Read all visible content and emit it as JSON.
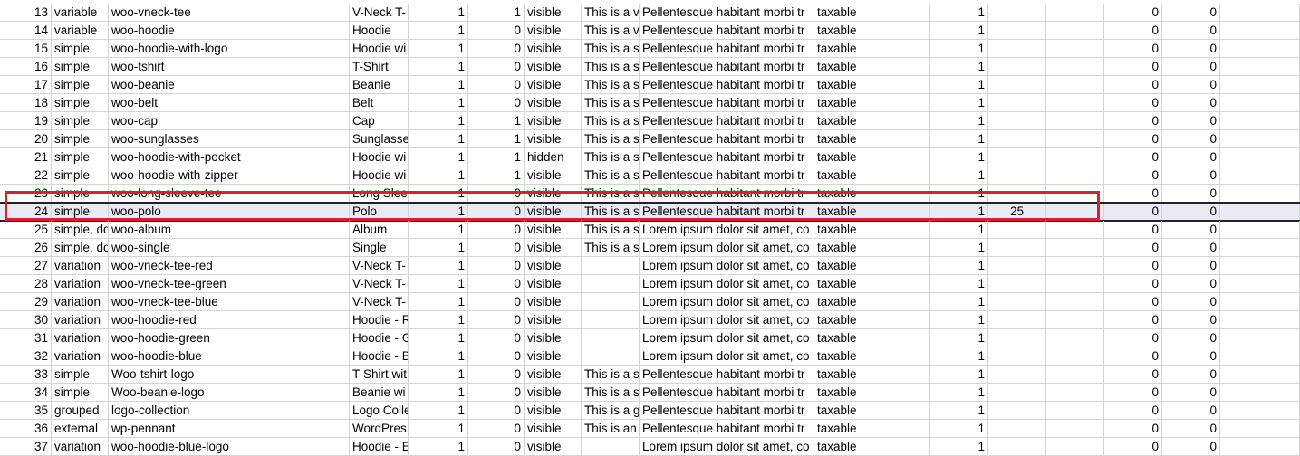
{
  "rows": [
    {
      "n": "13",
      "type": "variable",
      "sku": "woo-vneck-tee",
      "name": "V-Neck T-",
      "published": "1",
      "featured": "1",
      "visibility": "visible",
      "short": "This is a va",
      "desc": "Pellentesque habitant morbi tr",
      "tax": "taxable",
      "instock": "1",
      "stock": "",
      "v1": "0",
      "v2": "0"
    },
    {
      "n": "14",
      "type": "variable",
      "sku": "woo-hoodie",
      "name": "Hoodie",
      "published": "1",
      "featured": "0",
      "visibility": "visible",
      "short": "This is a va",
      "desc": "Pellentesque habitant morbi tr",
      "tax": "taxable",
      "instock": "1",
      "stock": "",
      "v1": "0",
      "v2": "0"
    },
    {
      "n": "15",
      "type": "simple",
      "sku": "woo-hoodie-with-logo",
      "name": "Hoodie wi",
      "published": "1",
      "featured": "0",
      "visibility": "visible",
      "short": "This is a si",
      "desc": "Pellentesque habitant morbi tr",
      "tax": "taxable",
      "instock": "1",
      "stock": "",
      "v1": "0",
      "v2": "0"
    },
    {
      "n": "16",
      "type": "simple",
      "sku": "woo-tshirt",
      "name": "T-Shirt",
      "published": "1",
      "featured": "0",
      "visibility": "visible",
      "short": "This is a si",
      "desc": "Pellentesque habitant morbi tr",
      "tax": "taxable",
      "instock": "1",
      "stock": "",
      "v1": "0",
      "v2": "0"
    },
    {
      "n": "17",
      "type": "simple",
      "sku": "woo-beanie",
      "name": "Beanie",
      "published": "1",
      "featured": "0",
      "visibility": "visible",
      "short": "This is a si",
      "desc": "Pellentesque habitant morbi tr",
      "tax": "taxable",
      "instock": "1",
      "stock": "",
      "v1": "0",
      "v2": "0"
    },
    {
      "n": "18",
      "type": "simple",
      "sku": "woo-belt",
      "name": "Belt",
      "published": "1",
      "featured": "0",
      "visibility": "visible",
      "short": "This is a si",
      "desc": "Pellentesque habitant morbi tr",
      "tax": "taxable",
      "instock": "1",
      "stock": "",
      "v1": "0",
      "v2": "0"
    },
    {
      "n": "19",
      "type": "simple",
      "sku": "woo-cap",
      "name": "Cap",
      "published": "1",
      "featured": "1",
      "visibility": "visible",
      "short": "This is a si",
      "desc": "Pellentesque habitant morbi tr",
      "tax": "taxable",
      "instock": "1",
      "stock": "",
      "v1": "0",
      "v2": "0"
    },
    {
      "n": "20",
      "type": "simple",
      "sku": "woo-sunglasses",
      "name": "Sunglasse",
      "published": "1",
      "featured": "1",
      "visibility": "visible",
      "short": "This is a si",
      "desc": "Pellentesque habitant morbi tr",
      "tax": "taxable",
      "instock": "1",
      "stock": "",
      "v1": "0",
      "v2": "0"
    },
    {
      "n": "21",
      "type": "simple",
      "sku": "woo-hoodie-with-pocket",
      "name": "Hoodie wi",
      "published": "1",
      "featured": "1",
      "visibility": "hidden",
      "short": "This is a si",
      "desc": "Pellentesque habitant morbi tr",
      "tax": "taxable",
      "instock": "1",
      "stock": "",
      "v1": "0",
      "v2": "0"
    },
    {
      "n": "22",
      "type": "simple",
      "sku": "woo-hoodie-with-zipper",
      "name": "Hoodie wi",
      "published": "1",
      "featured": "1",
      "visibility": "visible",
      "short": "This is a si",
      "desc": "Pellentesque habitant morbi tr",
      "tax": "taxable",
      "instock": "1",
      "stock": "",
      "v1": "0",
      "v2": "0"
    },
    {
      "n": "23",
      "type": "simple",
      "sku": "woo-long-sleeve-tee",
      "name": "Long Slee",
      "published": "1",
      "featured": "0",
      "visibility": "visible",
      "short": "This is a si",
      "desc": "Pellentesque habitant morbi tr",
      "tax": "taxable",
      "instock": "1",
      "stock": "",
      "v1": "0",
      "v2": "0"
    },
    {
      "n": "24",
      "type": "simple",
      "sku": "woo-polo",
      "name": "Polo",
      "published": "1",
      "featured": "0",
      "visibility": "visible",
      "short": "This is a si",
      "desc": "Pellentesque habitant morbi tr",
      "tax": "taxable",
      "instock": "1",
      "stock": "25",
      "v1": "0",
      "v2": "0",
      "selected": true
    },
    {
      "n": "25",
      "type": "simple, do",
      "sku": "woo-album",
      "name": "Album",
      "published": "1",
      "featured": "0",
      "visibility": "visible",
      "short": "This is a si",
      "desc": "Lorem ipsum dolor sit amet, co",
      "tax": "taxable",
      "instock": "1",
      "stock": "",
      "v1": "0",
      "v2": "0"
    },
    {
      "n": "26",
      "type": "simple, do",
      "sku": "woo-single",
      "name": "Single",
      "published": "1",
      "featured": "0",
      "visibility": "visible",
      "short": "This is a si",
      "desc": "Lorem ipsum dolor sit amet, co",
      "tax": "taxable",
      "instock": "1",
      "stock": "",
      "v1": "0",
      "v2": "0"
    },
    {
      "n": "27",
      "type": "variation",
      "sku": "woo-vneck-tee-red",
      "name": "V-Neck T-",
      "published": "1",
      "featured": "0",
      "visibility": "visible",
      "short": "",
      "desc": "Lorem ipsum dolor sit amet, co",
      "tax": "taxable",
      "instock": "1",
      "stock": "",
      "v1": "0",
      "v2": "0"
    },
    {
      "n": "28",
      "type": "variation",
      "sku": "woo-vneck-tee-green",
      "name": "V-Neck T-",
      "published": "1",
      "featured": "0",
      "visibility": "visible",
      "short": "",
      "desc": "Lorem ipsum dolor sit amet, co",
      "tax": "taxable",
      "instock": "1",
      "stock": "",
      "v1": "0",
      "v2": "0"
    },
    {
      "n": "29",
      "type": "variation",
      "sku": "woo-vneck-tee-blue",
      "name": "V-Neck T-",
      "published": "1",
      "featured": "0",
      "visibility": "visible",
      "short": "",
      "desc": "Lorem ipsum dolor sit amet, co",
      "tax": "taxable",
      "instock": "1",
      "stock": "",
      "v1": "0",
      "v2": "0"
    },
    {
      "n": "30",
      "type": "variation",
      "sku": "woo-hoodie-red",
      "name": "Hoodie - R",
      "published": "1",
      "featured": "0",
      "visibility": "visible",
      "short": "",
      "desc": "Lorem ipsum dolor sit amet, co",
      "tax": "taxable",
      "instock": "1",
      "stock": "",
      "v1": "0",
      "v2": "0"
    },
    {
      "n": "31",
      "type": "variation",
      "sku": "woo-hoodie-green",
      "name": "Hoodie - G",
      "published": "1",
      "featured": "0",
      "visibility": "visible",
      "short": "",
      "desc": "Lorem ipsum dolor sit amet, co",
      "tax": "taxable",
      "instock": "1",
      "stock": "",
      "v1": "0",
      "v2": "0"
    },
    {
      "n": "32",
      "type": "variation",
      "sku": "woo-hoodie-blue",
      "name": "Hoodie - B",
      "published": "1",
      "featured": "0",
      "visibility": "visible",
      "short": "",
      "desc": "Lorem ipsum dolor sit amet, co",
      "tax": "taxable",
      "instock": "1",
      "stock": "",
      "v1": "0",
      "v2": "0"
    },
    {
      "n": "33",
      "type": "simple",
      "sku": "Woo-tshirt-logo",
      "name": "T-Shirt wit",
      "published": "1",
      "featured": "0",
      "visibility": "visible",
      "short": "This is a si",
      "desc": "Pellentesque habitant morbi tr",
      "tax": "taxable",
      "instock": "1",
      "stock": "",
      "v1": "0",
      "v2": "0"
    },
    {
      "n": "34",
      "type": "simple",
      "sku": "Woo-beanie-logo",
      "name": "Beanie wi",
      "published": "1",
      "featured": "0",
      "visibility": "visible",
      "short": "This is a si",
      "desc": "Pellentesque habitant morbi tr",
      "tax": "taxable",
      "instock": "1",
      "stock": "",
      "v1": "0",
      "v2": "0"
    },
    {
      "n": "35",
      "type": "grouped",
      "sku": "logo-collection",
      "name": "Logo Colle",
      "published": "1",
      "featured": "0",
      "visibility": "visible",
      "short": "This is a gr",
      "desc": "Pellentesque habitant morbi tr",
      "tax": "taxable",
      "instock": "1",
      "stock": "",
      "v1": "0",
      "v2": "0"
    },
    {
      "n": "36",
      "type": "external",
      "sku": "wp-pennant",
      "name": "WordPres",
      "published": "1",
      "featured": "0",
      "visibility": "visible",
      "short": "This is an (",
      "desc": "Pellentesque habitant morbi tr",
      "tax": "taxable",
      "instock": "1",
      "stock": "",
      "v1": "0",
      "v2": "0"
    },
    {
      "n": "37",
      "type": "variation",
      "sku": "woo-hoodie-blue-logo",
      "name": "Hoodie - E",
      "published": "1",
      "featured": "0",
      "visibility": "visible",
      "short": "",
      "desc": "Lorem ipsum dolor sit amet, co",
      "tax": "taxable",
      "instock": "1",
      "stock": "",
      "v1": "0",
      "v2": "0"
    }
  ],
  "colors": {
    "highlight": "#d9202c",
    "selected_row_bg": "#e8eaf4",
    "gridline": "#d4d4d4"
  }
}
